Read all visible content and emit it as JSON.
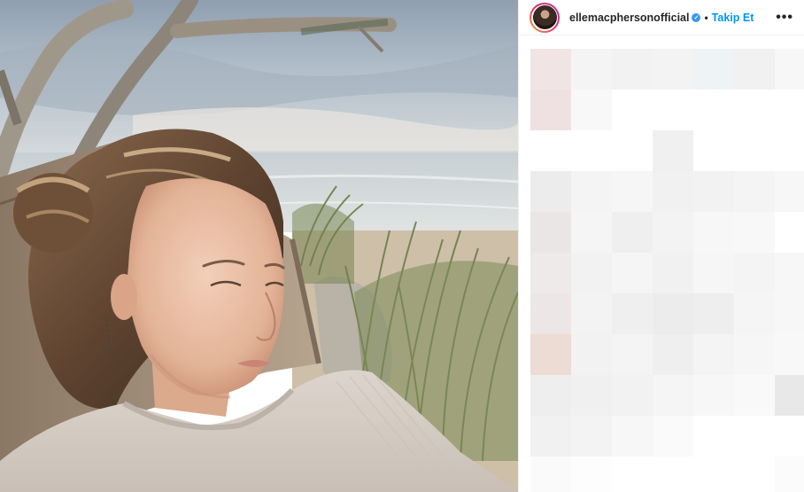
{
  "post": {
    "username": "ellemacphersonofficial",
    "verified_icon": "verified-badge-icon",
    "separator": "•",
    "follow_label": "Takip Et",
    "more_icon": "ellipsis-icon",
    "more_glyph": "•••",
    "photo_icon": "selfie-photo",
    "caption_state": "pixelated",
    "footer_left": "",
    "footer_right": ""
  },
  "colors": {
    "accent": "#0095f6",
    "verified": "#3897f0",
    "text": "#262626"
  }
}
